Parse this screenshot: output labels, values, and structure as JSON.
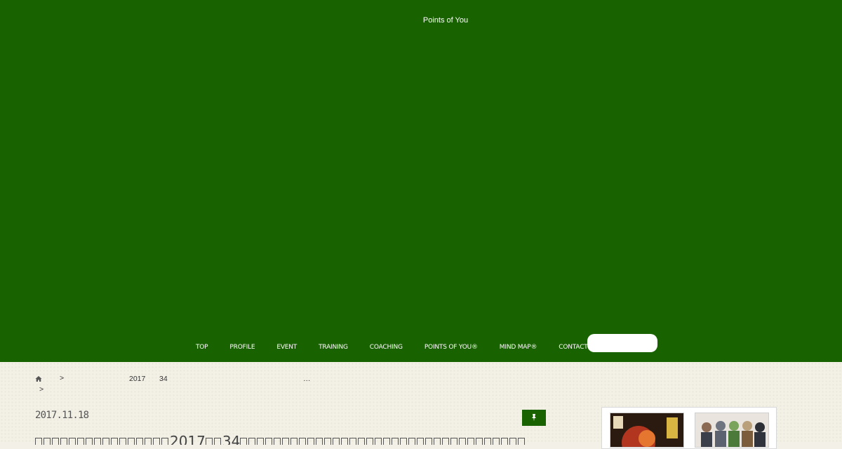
{
  "site": {
    "title": "Points of You"
  },
  "nav": {
    "items": [
      {
        "label": "TOP"
      },
      {
        "label": "PROFILE"
      },
      {
        "label": "EVENT"
      },
      {
        "label": "TRAINING"
      },
      {
        "label": "COACHING"
      },
      {
        "label": "POINTS OF YOU®"
      },
      {
        "label": "MIND MAP®"
      },
      {
        "label": "CONTACT"
      }
    ],
    "search": {
      "value": "",
      "placeholder": ""
    }
  },
  "breadcrumb": {
    "sep1": ">",
    "year": "2017",
    "num": "34",
    "ellipsis": "…",
    "sep2": ">"
  },
  "post": {
    "date": "2017.11.18",
    "title": {
      "prefix_boxes": 16,
      "year": "2017",
      "num": "34"
    }
  },
  "icons": {
    "home": "home-icon",
    "search": "search-icon",
    "pin": "pushpin-icon"
  },
  "colors": {
    "header_green": "#196200",
    "paper": "#f3f0e6",
    "text": "#333333"
  }
}
